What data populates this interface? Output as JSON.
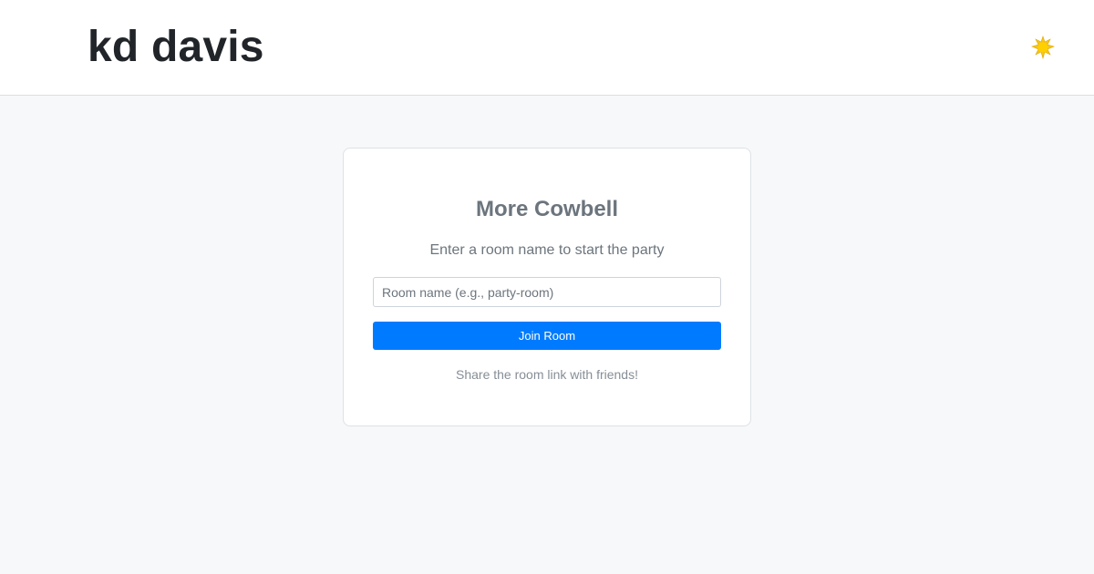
{
  "header": {
    "brand": "kd davis",
    "theme_icon": "sun-icon"
  },
  "card": {
    "title": "More Cowbell",
    "subtitle": "Enter a room name to start the party",
    "input": {
      "value": "",
      "placeholder": "Room name (e.g., party-room)"
    },
    "join_label": "Join Room",
    "hint": "Share the room link with friends!"
  },
  "colors": {
    "accent": "#007bff",
    "sun": "#f5c518"
  }
}
